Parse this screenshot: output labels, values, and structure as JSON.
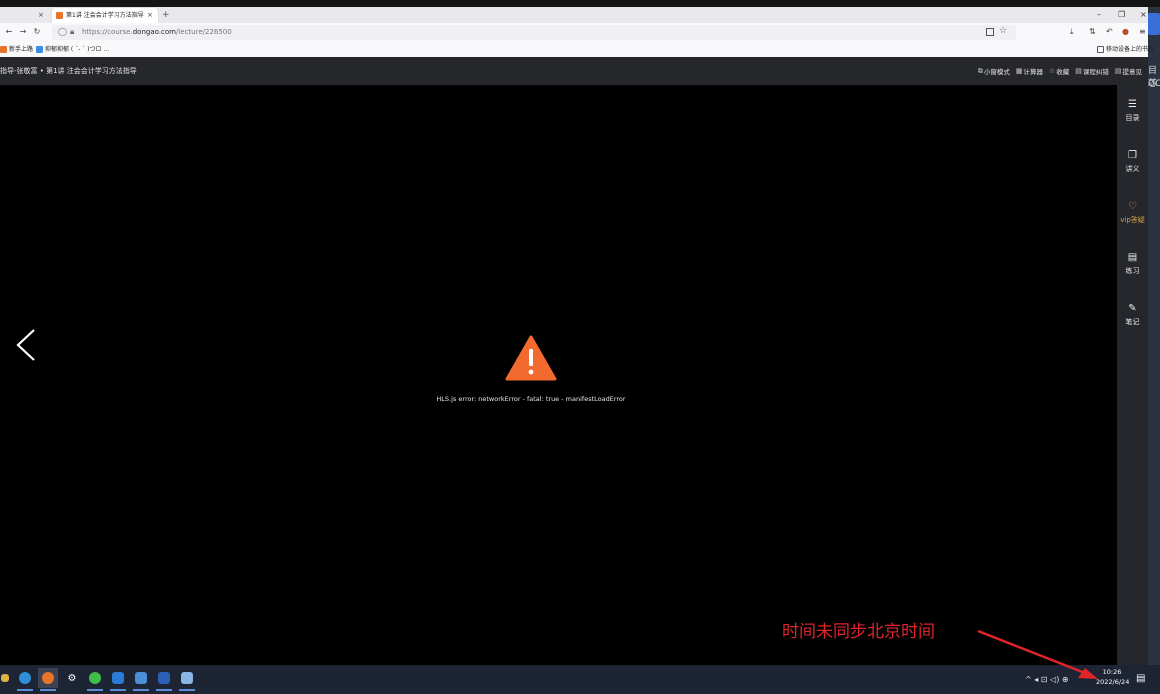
{
  "browser": {
    "prev_tab_close": "×",
    "active_tab_title": "第1讲 注会会计学习方法指导",
    "active_tab_close": "×",
    "new_tab": "+",
    "window_minimize": "–",
    "window_maximize": "❐",
    "window_close": "×",
    "url_prefix": "https://course.",
    "url_domain": "dongao.com",
    "url_path": "/lecture/226500",
    "bookmarks": [
      {
        "label": "新手上路",
        "color": "#e8742a"
      },
      {
        "label": "抑郁抑郁 ( ´- ` )つロ ...",
        "color": "#3a8fe0"
      }
    ],
    "mobile_bookmarks": "移动设备上的书签"
  },
  "course": {
    "title": "指导-张敬富 • 第1讲 注会会计学习方法指导",
    "tools": [
      {
        "icon": "⧉",
        "label": "小窗模式"
      },
      {
        "icon": "▦",
        "label": "计算器"
      },
      {
        "icon": "☆",
        "label": "收藏"
      },
      {
        "icon": "▤",
        "label": "课程纠错"
      },
      {
        "icon": "▤",
        "label": "提意见"
      }
    ]
  },
  "player": {
    "error_message": "HLS.js error: networkError - fatal: true - manifestLoadError"
  },
  "sidebar": {
    "items": [
      {
        "icon": "☰",
        "label": "目录"
      },
      {
        "icon": "❐",
        "label": "讲义"
      },
      {
        "icon": "♡",
        "label": "vip答疑"
      },
      {
        "icon": "▤",
        "label": "练习"
      },
      {
        "icon": "✎",
        "label": "笔记"
      }
    ]
  },
  "annotation": {
    "text": "时间未同步北京时间"
  },
  "taskbar": {
    "time": "10:26",
    "date": "2022/6/24",
    "tray_icons": "^ ◂ ⊡ ◁) ⊕"
  },
  "desktop_sliver": {
    "t1": "目芯",
    "t2": "OC"
  },
  "colors": {
    "warning": "#f26a2e",
    "annotation": "#e0242a",
    "vip": "#d4a14a"
  }
}
